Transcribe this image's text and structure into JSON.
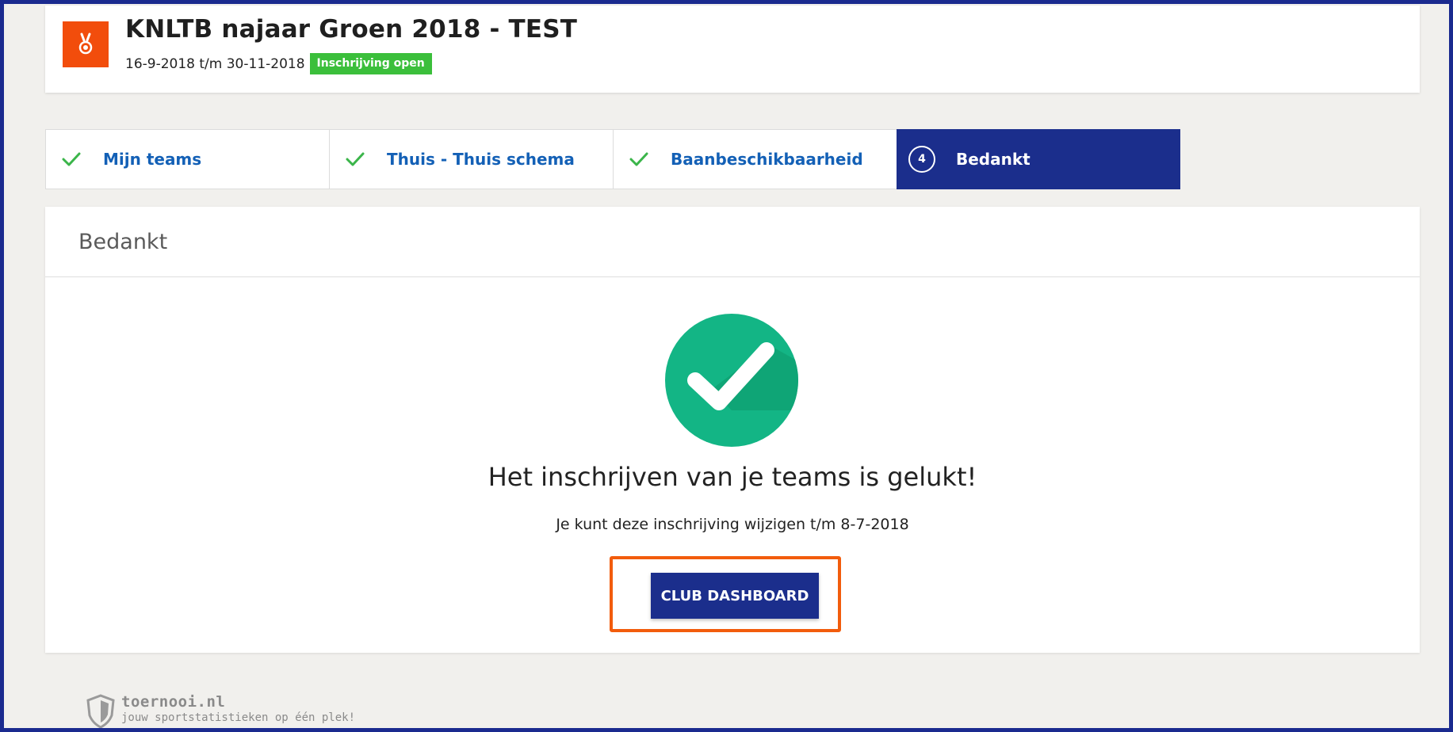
{
  "header": {
    "title": "KNLTB najaar Groen 2018 - TEST",
    "dates": "16-9-2018 t/m 30-11-2018",
    "status": "Inschrijving open",
    "logo_icon": "medal-icon",
    "logo_color": "#f24d0c",
    "status_color": "#3bbf3b"
  },
  "steps": [
    {
      "label": "Mijn teams",
      "state": "completed",
      "icon": "check-icon"
    },
    {
      "label": "Thuis - Thuis schema",
      "state": "completed",
      "icon": "check-icon"
    },
    {
      "label": "Baanbeschikbaarheid",
      "state": "completed",
      "icon": "check-icon"
    },
    {
      "number": "4",
      "label": "Bedankt",
      "state": "active"
    }
  ],
  "main": {
    "title": "Bedankt",
    "success_icon": "success-check-icon",
    "message": "Het inschrijven van je teams is gelukt!",
    "edit_note": "Je kunt deze inschrijving wijzigen t/m 8-7-2018",
    "button_label": "CLUB DASHBOARD"
  },
  "footer": {
    "brand_name": "toernooi.nl",
    "tagline": "jouw sportstatistieken op één plek!",
    "brand_icon": "shield-icon"
  },
  "colors": {
    "primary": "#1b2e8c",
    "link": "#1360b6",
    "success": "#13b585",
    "highlight": "#f25c0c"
  }
}
